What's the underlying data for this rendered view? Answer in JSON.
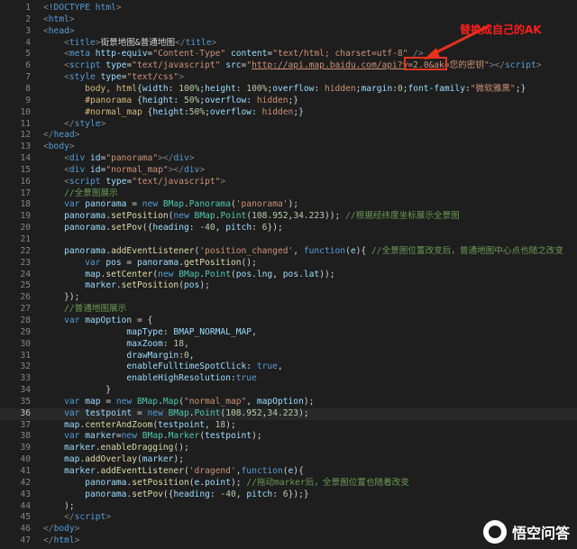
{
  "editor": {
    "active_line": 36,
    "lines": [
      {
        "n": "1",
        "html": "<span class='br'>&lt;</span><span class='tag'>!DOCTYPE html</span><span class='br'>&gt;</span>"
      },
      {
        "n": "2",
        "html": "<span class='br'>&lt;</span><span class='tag'>html</span><span class='br'>&gt;</span>"
      },
      {
        "n": "3",
        "html": "<span class='br'>&lt;</span><span class='tag'>head</span><span class='br'>&gt;</span>"
      },
      {
        "n": "4",
        "html": "    <span class='br'>&lt;</span><span class='tag'>title</span><span class='br'>&gt;</span>街景地图&amp;普通地图<span class='br'>&lt;/</span><span class='tag'>title</span><span class='br'>&gt;</span>"
      },
      {
        "n": "5",
        "html": "    <span class='br'>&lt;</span><span class='tag'>meta</span> <span class='att'>http-equiv</span>=<span class='str'>\"Content-Type\"</span> <span class='att'>content</span>=<span class='str'>\"text/html; charset=utf-8\"</span> <span class='br'>/&gt;</span>"
      },
      {
        "n": "6",
        "html": "    <span class='br'>&lt;</span><span class='tag'>script</span> <span class='att'>type</span>=<span class='str'>\"text/javascript\"</span> <span class='att'>src</span>=<span class='str'>\"</span><span class='url'>http://api.map.baidu.com/api?v=2.0&amp;ak</span><span class='str'>=您的密钥\"</span><span class='br'>&gt;&lt;/</span><span class='tag'>script</span><span class='br'>&gt;</span>"
      },
      {
        "n": "7",
        "html": "    <span class='br'>&lt;</span><span class='tag'>style</span> <span class='att'>type</span>=<span class='str'>\"text/css\"</span><span class='br'>&gt;</span>"
      },
      {
        "n": "8",
        "html": "        <span class='css'>body, html</span>{<span class='prop'>width</span>: <span class='num'>100%</span>;<span class='prop'>height</span>: <span class='num'>100%</span>;<span class='prop'>overflow</span>: <span class='str'>hidden</span>;<span class='prop'>margin</span>:<span class='num'>0</span>;<span class='prop'>font-family</span>:<span class='str'>\"微软雅黑\"</span>;}"
      },
      {
        "n": "9",
        "html": "        <span class='css'>#panorama</span> {<span class='prop'>height</span>: <span class='num'>50%</span>;<span class='prop'>overflow</span>: <span class='str'>hidden</span>;}"
      },
      {
        "n": "10",
        "html": "        <span class='css'>#normal_map</span> {<span class='prop'>height</span>:<span class='num'>50%</span>;<span class='prop'>overflow</span>: <span class='str'>hidden</span>;}"
      },
      {
        "n": "11",
        "html": "    <span class='br'>&lt;/</span><span class='tag'>style</span><span class='br'>&gt;</span>"
      },
      {
        "n": "12",
        "html": "<span class='br'>&lt;/</span><span class='tag'>head</span><span class='br'>&gt;</span>"
      },
      {
        "n": "13",
        "html": "<span class='br'>&lt;</span><span class='tag'>body</span><span class='br'>&gt;</span>"
      },
      {
        "n": "14",
        "html": "    <span class='br'>&lt;</span><span class='tag'>div</span> <span class='att'>id</span>=<span class='str'>\"panorama\"</span><span class='br'>&gt;&lt;/</span><span class='tag'>div</span><span class='br'>&gt;</span>"
      },
      {
        "n": "15",
        "html": "    <span class='br'>&lt;</span><span class='tag'>div</span> <span class='att'>id</span>=<span class='str'>\"normal_map\"</span><span class='br'>&gt;&lt;/</span><span class='tag'>div</span><span class='br'>&gt;</span>"
      },
      {
        "n": "16",
        "html": "    <span class='br'>&lt;</span><span class='tag'>script</span> <span class='att'>type</span>=<span class='str'>\"text/javascript\"</span><span class='br'>&gt;</span>"
      },
      {
        "n": "17",
        "html": "    <span class='cm'>//全景图展示</span>"
      },
      {
        "n": "18",
        "html": "    <span class='kw'>var</span> <span class='var'>panorama</span> = <span class='kw'>new</span> <span class='cls'>BMap</span>.<span class='cls'>Panorama</span>(<span class='str'>'panorama'</span>);"
      },
      {
        "n": "19",
        "html": "    <span class='var'>panorama</span>.<span class='fn'>setPosition</span>(<span class='kw'>new</span> <span class='cls'>BMap</span>.<span class='cls'>Point</span>(<span class='num'>108.952</span>,<span class='num'>34.223</span>)); <span class='cm'>//根据经纬度坐标展示全景图</span>"
      },
      {
        "n": "20",
        "html": "    <span class='var'>panorama</span>.<span class='fn'>setPov</span>({<span class='var'>heading</span>: <span class='num'>-40</span>, <span class='var'>pitch</span>: <span class='num'>6</span>});"
      },
      {
        "n": "21",
        "html": ""
      },
      {
        "n": "22",
        "html": "    <span class='var'>panorama</span>.<span class='fn'>addEventListener</span>(<span class='str'>'position_changed'</span>, <span class='kw'>function</span>(<span class='var'>e</span>){ <span class='cm'>//全景图位置改变后，普通地图中心点也随之改变</span>"
      },
      {
        "n": "23",
        "html": "        <span class='kw'>var</span> <span class='var'>pos</span> = <span class='var'>panorama</span>.<span class='fn'>getPosition</span>();"
      },
      {
        "n": "24",
        "html": "        <span class='var'>map</span>.<span class='fn'>setCenter</span>(<span class='kw'>new</span> <span class='cls'>BMap</span>.<span class='cls'>Point</span>(<span class='var'>pos</span>.<span class='var'>lng</span>, <span class='var'>pos</span>.<span class='var'>lat</span>));"
      },
      {
        "n": "25",
        "html": "        <span class='var'>marker</span>.<span class='fn'>setPosition</span>(<span class='var'>pos</span>);"
      },
      {
        "n": "26",
        "html": "    });"
      },
      {
        "n": "27",
        "html": "    <span class='cm'>//普通地图展示</span>"
      },
      {
        "n": "28",
        "html": "    <span class='kw'>var</span> <span class='var'>mapOption</span> = {"
      },
      {
        "n": "29",
        "html": "                <span class='var'>mapType</span>: <span class='var'>BMAP_NORMAL_MAP</span>,"
      },
      {
        "n": "30",
        "html": "                <span class='var'>maxZoom</span>: <span class='num'>18</span>,"
      },
      {
        "n": "31",
        "html": "                <span class='var'>drawMargin</span>:<span class='num'>0</span>,"
      },
      {
        "n": "32",
        "html": "                <span class='var'>enableFulltimeSpotClick</span>: <span class='kw'>true</span>,"
      },
      {
        "n": "33",
        "html": "                <span class='var'>enableHighResolution</span>:<span class='kw'>true</span>"
      },
      {
        "n": "34",
        "html": "            }"
      },
      {
        "n": "35",
        "html": "    <span class='kw'>var</span> <span class='var'>map</span> = <span class='kw'>new</span> <span class='cls'>BMap</span>.<span class='cls'>Map</span>(<span class='str'>\"normal_map\"</span>, <span class='var'>mapOption</span>);"
      },
      {
        "n": "36",
        "html": "    <span class='kw'>var</span> <span class='var'>testpoint</span> = <span class='kw'>new</span> <span class='cls'>BMap</span>.<span class='cls'>Point</span>(<span class='num'>108.952</span>,<span class='num'>34.223</span>);"
      },
      {
        "n": "37",
        "html": "    <span class='var'>map</span>.<span class='fn'>centerAndZoom</span>(<span class='var'>testpoint</span>, <span class='num'>18</span>);"
      },
      {
        "n": "38",
        "html": "    <span class='kw'>var</span> <span class='var'>marker</span>=<span class='kw'>new</span> <span class='cls'>BMap</span>.<span class='cls'>Marker</span>(<span class='var'>testpoint</span>);"
      },
      {
        "n": "39",
        "html": "    <span class='var'>marker</span>.<span class='fn'>enableDragging</span>();"
      },
      {
        "n": "40",
        "html": "    <span class='var'>map</span>.<span class='fn'>addOverlay</span>(<span class='var'>marker</span>);"
      },
      {
        "n": "41",
        "html": "    <span class='var'>marker</span>.<span class='fn'>addEventListener</span>(<span class='str'>'dragend'</span>,<span class='kw'>function</span>(<span class='var'>e</span>){"
      },
      {
        "n": "42",
        "html": "        <span class='var'>panorama</span>.<span class='fn'>setPosition</span>(<span class='var'>e</span>.<span class='var'>point</span>); <span class='cm'>//拖动marker后，全景图位置也随着改变</span>"
      },
      {
        "n": "43",
        "html": "        <span class='var'>panorama</span>.<span class='fn'>setPov</span>({<span class='var'>heading</span>: <span class='num'>-40</span>, <span class='var'>pitch</span>: <span class='num'>6</span>});}"
      },
      {
        "n": "44",
        "html": "    );"
      },
      {
        "n": "45",
        "html": "    <span class='br'>&lt;/</span><span class='tag'>script</span><span class='br'>&gt;</span>"
      },
      {
        "n": "46",
        "html": "<span class='br'>&lt;/</span><span class='tag'>body</span><span class='br'>&gt;</span>"
      },
      {
        "n": "47",
        "html": "<span class='br'>&lt;/</span><span class='tag'>html</span><span class='br'>&gt;</span>"
      }
    ]
  },
  "annotation": {
    "text": "替换成自己的AK",
    "color": "#ff1e1e"
  },
  "watermark": {
    "text": "悟空问答",
    "icon": "wukong-logo-icon"
  }
}
